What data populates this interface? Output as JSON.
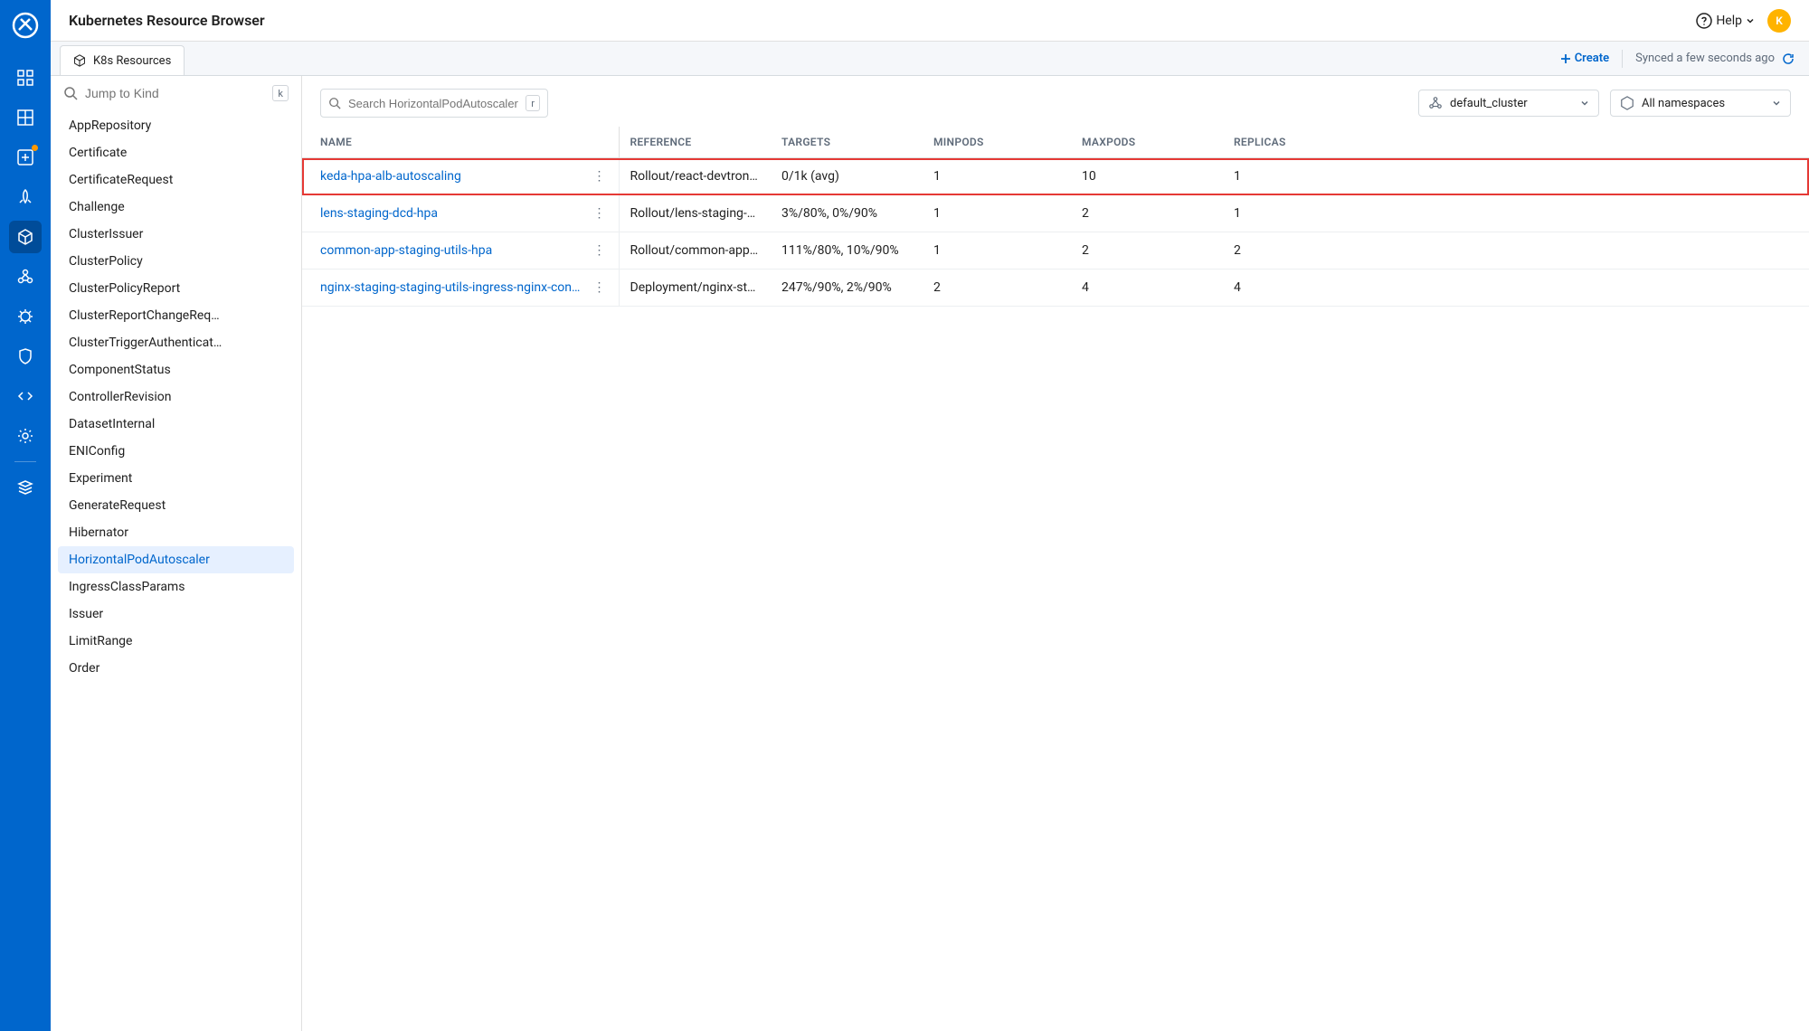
{
  "header": {
    "title": "Kubernetes Resource Browser",
    "help_label": "Help",
    "avatar_initial": "K"
  },
  "tab": {
    "label": "K8s Resources"
  },
  "toolbar": {
    "create_label": "Create",
    "sync_status": "Synced a few seconds ago"
  },
  "jump": {
    "placeholder": "Jump to Kind",
    "shortcut": "k"
  },
  "kinds": {
    "items": [
      "AppRepository",
      "Certificate",
      "CertificateRequest",
      "Challenge",
      "ClusterIssuer",
      "ClusterPolicy",
      "ClusterPolicyReport",
      "ClusterReportChangeReq…",
      "ClusterTriggerAuthenticat…",
      "ComponentStatus",
      "ControllerRevision",
      "DatasetInternal",
      "ENIConfig",
      "Experiment",
      "GenerateRequest",
      "Hibernator",
      "HorizontalPodAutoscaler",
      "IngressClassParams",
      "Issuer",
      "LimitRange",
      "Order"
    ],
    "active_index": 16
  },
  "search": {
    "placeholder": "Search HorizontalPodAutoscaler",
    "shortcut": "r"
  },
  "cluster_dropdown": {
    "label": "default_cluster"
  },
  "namespace_dropdown": {
    "label": "All namespaces"
  },
  "table": {
    "headers": {
      "name": "NAME",
      "reference": "REFERENCE",
      "targets": "TARGETS",
      "minpods": "MINPODS",
      "maxpods": "MAXPODS",
      "replicas": "REPLICAS"
    },
    "rows": [
      {
        "name": "keda-hpa-alb-autoscaling",
        "reference": "Rollout/react-devtron-…",
        "targets": "0/1k (avg)",
        "minpods": "1",
        "maxpods": "10",
        "replicas": "1",
        "highlight": true
      },
      {
        "name": "lens-staging-dcd-hpa",
        "reference": "Rollout/lens-staging-dcd",
        "targets": "3%/80%, 0%/90%",
        "minpods": "1",
        "maxpods": "2",
        "replicas": "1"
      },
      {
        "name": "common-app-staging-utils-hpa",
        "reference": "Rollout/common-app-s…",
        "targets": "111%/80%, 10%/90%",
        "minpods": "1",
        "maxpods": "2",
        "replicas": "2"
      },
      {
        "name": "nginx-staging-staging-utils-ingress-nginx-contro…",
        "reference": "Deployment/nginx-sta…",
        "targets": "247%/90%, 2%/90%",
        "minpods": "2",
        "maxpods": "4",
        "replicas": "4"
      }
    ]
  }
}
